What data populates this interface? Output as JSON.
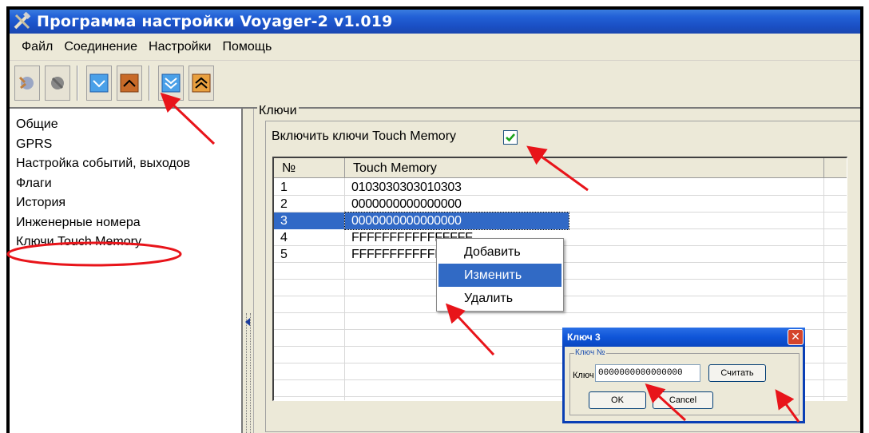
{
  "window": {
    "title": "Программа настройки Voyager-2 v1.019"
  },
  "menu": [
    "Файл",
    "Соединение",
    "Настройки",
    "Помощь"
  ],
  "sidebar": {
    "items": [
      {
        "label": "Общие"
      },
      {
        "label": "GPRS"
      },
      {
        "label": "Настройка событий, выходов"
      },
      {
        "label": "Флаги"
      },
      {
        "label": "История"
      },
      {
        "label": "Инженерные номера"
      },
      {
        "label": "Ключи Touch Memory"
      }
    ]
  },
  "keys": {
    "group_title": "Ключи",
    "enable_label": "Включить ключи Touch Memory",
    "enabled": true,
    "columns": [
      "№",
      "Touch Memory"
    ],
    "rows": [
      {
        "n": "1",
        "code": "0103030303010303"
      },
      {
        "n": "2",
        "code": "0000000000000000"
      },
      {
        "n": "3",
        "code": "0000000000000000"
      },
      {
        "n": "4",
        "code": "FFFFFFFFFFFFFFFF"
      },
      {
        "n": "5",
        "code": "FFFFFFFFFFFFFFFF"
      }
    ],
    "selected_row": 3
  },
  "context_menu": {
    "items": [
      "Добавить",
      "Изменить",
      "Удалить"
    ],
    "highlighted": "Изменить"
  },
  "dialog": {
    "title": "Ключ 3",
    "group_title": "Ключ №",
    "field_label": "Ключ",
    "field_value": "0000000000000000",
    "read_button": "Считать",
    "ok_button": "OK",
    "cancel_button": "Cancel"
  },
  "colors": {
    "title_bar": "#1a4fc4",
    "selection": "#3169c6",
    "arrow": "#e8141a",
    "highlight_ellipse": "#e8141a",
    "checkbox_check": "#1aa31a"
  }
}
